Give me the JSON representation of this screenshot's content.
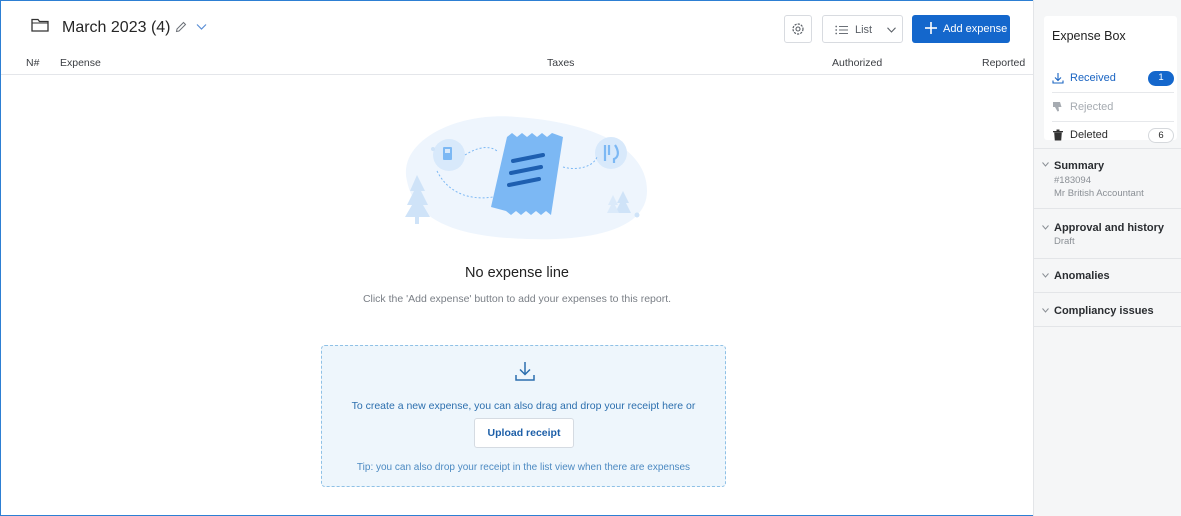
{
  "header": {
    "title": "March 2023 (4)",
    "list_label": "List",
    "add_label": "Add expense"
  },
  "table": {
    "columns": [
      "N#",
      "Expense",
      "Taxes",
      "Authorized",
      "Reported"
    ]
  },
  "empty": {
    "title": "No expense line",
    "subtitle": "Click the 'Add expense' button to add your expenses to this report."
  },
  "dropzone": {
    "text": "To create a new expense, you can also drag and drop your receipt here or",
    "upload_label": "Upload receipt",
    "tip": "Tip: you can also drop your receipt in the list view when there are expenses"
  },
  "sidebar": {
    "box_title": "Expense Box",
    "received": {
      "label": "Received",
      "count": "1"
    },
    "rejected": {
      "label": "Rejected"
    },
    "deleted": {
      "label": "Deleted",
      "count": "6"
    },
    "summary": {
      "title": "Summary",
      "number": "#183094",
      "owner": "Mr British Accountant"
    },
    "approval": {
      "title": "Approval and history",
      "status": "Draft"
    },
    "anomalies": {
      "title": "Anomalies"
    },
    "compliancy": {
      "title": "Compliancy issues"
    }
  },
  "colors": {
    "accent": "#1467cc",
    "frame": "#2d7fd3",
    "illustration": "#7cb8f4"
  },
  "icons": [
    "folder-icon",
    "pencil-icon",
    "chevron-down-icon",
    "gear-icon",
    "list-icon",
    "plus-icon",
    "download-icon",
    "thumbs-down-icon",
    "trash-icon"
  ]
}
